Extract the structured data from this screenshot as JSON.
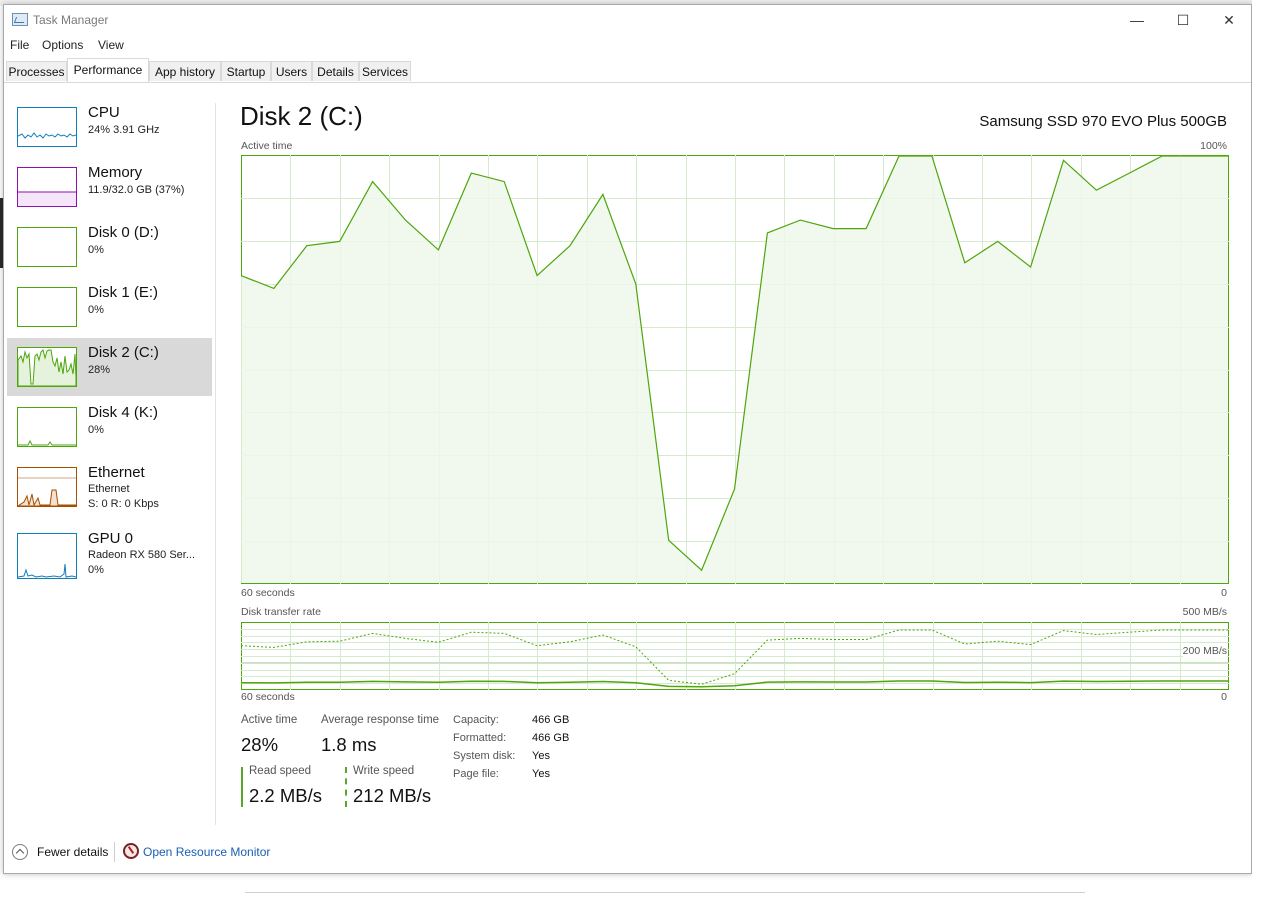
{
  "window": {
    "title": "Task Manager",
    "minimize_glyph": "—",
    "maximize_glyph": "☐",
    "close_glyph": "✕"
  },
  "menu": {
    "file": "File",
    "options": "Options",
    "view": "View"
  },
  "tabs": [
    "Processes",
    "Performance",
    "App history",
    "Startup",
    "Users",
    "Details",
    "Services"
  ],
  "active_tab": "Performance",
  "sidebar": {
    "items": [
      {
        "name": "CPU",
        "line1": "24%  3.91 GHz",
        "line2": "",
        "color": "#117dbb"
      },
      {
        "name": "Memory",
        "line1": "11.9/32.0 GB (37%)",
        "line2": "",
        "color": "#8b12ae"
      },
      {
        "name": "Disk 0 (D:)",
        "line1": "0%",
        "line2": "",
        "color": "#4da60c"
      },
      {
        "name": "Disk 1 (E:)",
        "line1": "0%",
        "line2": "",
        "color": "#4da60c"
      },
      {
        "name": "Disk 2 (C:)",
        "line1": "28%",
        "line2": "",
        "color": "#4da60c",
        "selected": true
      },
      {
        "name": "Disk 4 (K:)",
        "line1": "0%",
        "line2": "",
        "color": "#4da60c"
      },
      {
        "name": "Ethernet",
        "line1": "Ethernet",
        "line2": "S: 0  R: 0 Kbps",
        "color": "#a74f01"
      },
      {
        "name": "GPU 0",
        "line1": "Radeon RX 580 Ser...",
        "line2": "0%",
        "color": "#117dbb"
      }
    ]
  },
  "main": {
    "title": "Disk 2 (C:)",
    "model": "Samsung SSD 970 EVO Plus 500GB",
    "active_label": "Active time",
    "active_max": "100%",
    "time_left": "60 seconds",
    "time_right": "0",
    "rate_label": "Disk transfer rate",
    "rate_max": "500 MB/s",
    "rate_mid": "200 MB/s",
    "rate_time_left": "60 seconds",
    "rate_time_right": "0"
  },
  "stats": {
    "active_time_label": "Active time",
    "active_time_value": "28%",
    "avg_response_label": "Average response time",
    "avg_response_value": "1.8 ms",
    "read_label": "Read speed",
    "read_value": "2.2 MB/s",
    "write_label": "Write speed",
    "write_value": "212 MB/s"
  },
  "properties": [
    {
      "label": "Capacity:",
      "value": "466 GB"
    },
    {
      "label": "Formatted:",
      "value": "466 GB"
    },
    {
      "label": "System disk:",
      "value": "Yes"
    },
    {
      "label": "Page file:",
      "value": "Yes"
    }
  ],
  "footer": {
    "fewer_details": "Fewer details",
    "open_resource_monitor": "Open Resource Monitor"
  },
  "colors": {
    "disk_line": "#4da60c",
    "disk_fill": "#eef7ea",
    "grid": "#d6ead0",
    "link": "#1a5fb4"
  },
  "chart_data": [
    {
      "type": "area",
      "title": "Active time",
      "x": [
        60,
        58,
        56,
        54,
        52,
        50,
        48,
        46,
        44,
        42,
        40,
        38,
        36,
        34,
        32,
        30,
        28,
        26,
        24,
        22,
        20,
        18,
        16,
        14,
        12,
        10,
        8,
        6,
        4,
        2,
        0
      ],
      "values": [
        72,
        69,
        79,
        80,
        94,
        85,
        78,
        96,
        94,
        72,
        79,
        91,
        70,
        10,
        3,
        22,
        82,
        85,
        83,
        83,
        100,
        100,
        75,
        80,
        74,
        99,
        92,
        96,
        100,
        100,
        100
      ],
      "ylim": [
        0,
        100
      ],
      "xlabel": "60 seconds",
      "ylabel": "100%"
    },
    {
      "type": "line",
      "title": "Disk transfer rate",
      "series": [
        {
          "name": "Write speed",
          "style": "dashed"
        },
        {
          "name": "Read speed",
          "style": "solid"
        }
      ],
      "ylim": [
        0,
        500
      ],
      "reference": "200 MB/s"
    }
  ]
}
